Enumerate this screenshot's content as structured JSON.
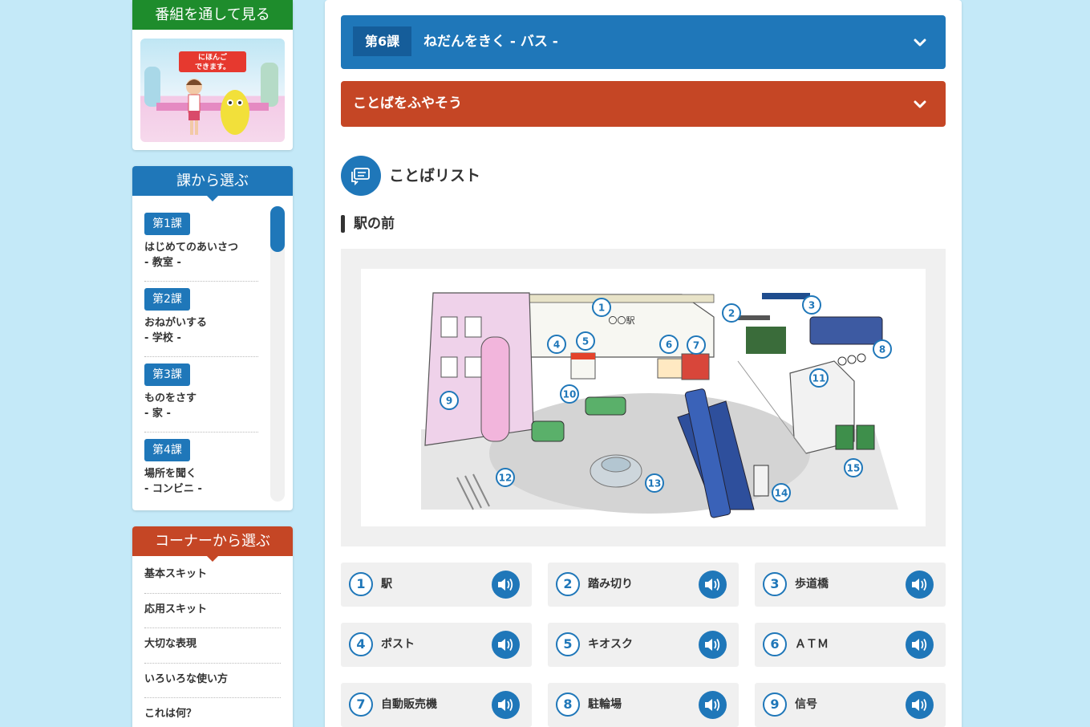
{
  "sidebar": {
    "program": {
      "heading": "番組を通して見る",
      "thumb_sign": "にほんご できます。"
    },
    "lessons": {
      "heading": "課から選ぶ",
      "items": [
        {
          "badge": "第1課",
          "title": "はじめてのあいさつ",
          "sub": "- 教室 -"
        },
        {
          "badge": "第2課",
          "title": "おねがいする",
          "sub": "- 学校 -"
        },
        {
          "badge": "第3課",
          "title": "ものをさす",
          "sub": "- 家 -"
        },
        {
          "badge": "第4課",
          "title": "場所を聞く",
          "sub": "- コンビニ -"
        }
      ]
    },
    "corners": {
      "heading": "コーナーから選ぶ",
      "items": [
        "基本スキット",
        "応用スキット",
        "大切な表現",
        "いろいろな使い方",
        "これは何？"
      ]
    }
  },
  "main": {
    "lesson_bar": {
      "badge": "第6課",
      "title": "ねだんをきく - バス -"
    },
    "words_bar": {
      "title": "ことばをふやそう"
    },
    "section_title": "ことばリスト",
    "sub_title": "駅の前",
    "illustration": {
      "station_sign": "〇〇駅",
      "markers": [
        "1",
        "2",
        "3",
        "4",
        "5",
        "6",
        "7",
        "8",
        "9",
        "10",
        "11",
        "12",
        "13",
        "14",
        "15"
      ]
    },
    "words": [
      {
        "num": "1",
        "label": "駅"
      },
      {
        "num": "2",
        "label": "踏み切り"
      },
      {
        "num": "3",
        "label": "歩道橋"
      },
      {
        "num": "4",
        "label": "ポスト"
      },
      {
        "num": "5",
        "label": "キオスク"
      },
      {
        "num": "6",
        "label": "ＡＴＭ"
      },
      {
        "num": "7",
        "label": "自動販売機"
      },
      {
        "num": "8",
        "label": "駐輪場"
      },
      {
        "num": "9",
        "label": "信号"
      }
    ]
  },
  "colors": {
    "blue": "#1f77b9",
    "red": "#c54625",
    "green": "#1e8c2c",
    "bg": "#c4e9f8"
  }
}
